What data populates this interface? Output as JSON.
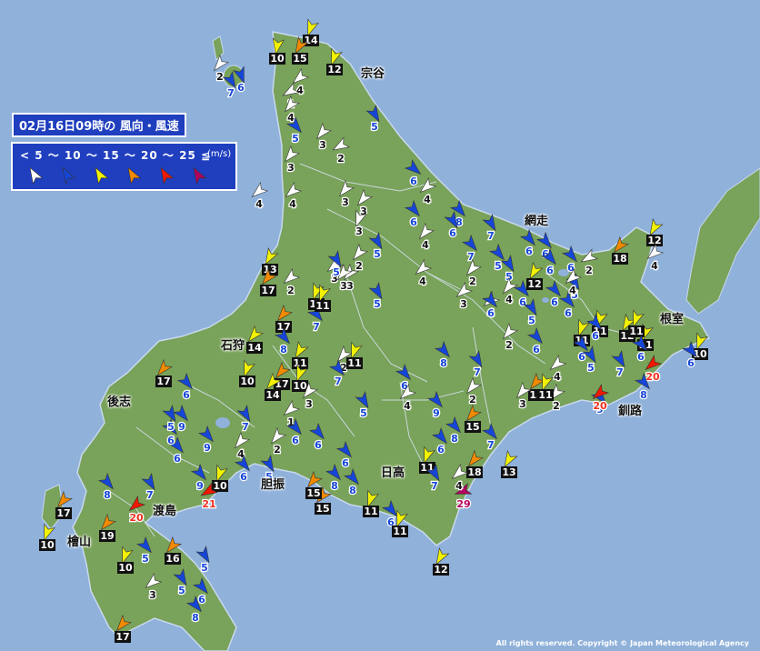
{
  "title": "02月16日09時の 風向・風速",
  "legend": {
    "scale": "< 5 ～ 10 ～ 15 ～ 20 ～ 25 ≦",
    "unit": "(m/s)",
    "levels": [
      {
        "color": "#ffffff"
      },
      {
        "color": "#1646d8"
      },
      {
        "color": "#f2f200"
      },
      {
        "color": "#f28a00"
      },
      {
        "color": "#f01800"
      },
      {
        "color": "#b3005e"
      }
    ]
  },
  "regions": {
    "soya": "宗谷",
    "abashiri": "網走",
    "nemuro": "根室",
    "ishikari": "石狩",
    "shiribeshi": "後志",
    "kushiro": "釧路",
    "iburi": "胆振",
    "hidaka": "日高",
    "oshima": "渡島",
    "hiyama": "檜山"
  },
  "copyright": "All rights reserved. Copyright © Japan Meteorological Agency",
  "colors": {
    "sea": "#8fb1da",
    "land": "#79a25a",
    "border": "#c9d8ee"
  },
  "observations": [
    {
      "speed": 14,
      "dir": 200
    },
    {
      "speed": 15,
      "dir": 210
    },
    {
      "speed": 10,
      "dir": 190
    },
    {
      "speed": 12,
      "dir": 200
    },
    {
      "speed": 2,
      "dir": 220
    },
    {
      "speed": 6,
      "dir": 160
    },
    {
      "speed": 7,
      "dir": 150
    },
    {
      "speed": 4,
      "dir": 230
    },
    {
      "speed": 1,
      "dir": 240
    },
    {
      "speed": 4,
      "dir": 220
    },
    {
      "speed": 5,
      "dir": 140
    },
    {
      "speed": 3,
      "dir": 220
    },
    {
      "speed": 5,
      "dir": 150
    },
    {
      "speed": 2,
      "dir": 240
    },
    {
      "speed": 3,
      "dir": 220
    },
    {
      "speed": 4,
      "dir": 230
    },
    {
      "speed": 6,
      "dir": 130
    },
    {
      "speed": 4,
      "dir": 230
    },
    {
      "speed": 8,
      "dir": 140
    },
    {
      "speed": 6,
      "dir": 140
    },
    {
      "speed": 6,
      "dir": 150
    },
    {
      "speed": 3,
      "dir": 220
    },
    {
      "speed": 3,
      "dir": 220
    },
    {
      "speed": 4,
      "dir": 230
    },
    {
      "speed": 3,
      "dir": 200
    },
    {
      "speed": 7,
      "dir": 150
    },
    {
      "speed": 5,
      "dir": 150
    },
    {
      "speed": 2,
      "dir": 220
    },
    {
      "speed": 3,
      "dir": 220
    },
    {
      "speed": 7,
      "dir": 140
    },
    {
      "speed": 4,
      "dir": 220
    },
    {
      "speed": 13,
      "dir": 210
    },
    {
      "speed": 17,
      "dir": 220
    },
    {
      "speed": 2,
      "dir": 230
    },
    {
      "speed": 11,
      "dir": 200
    },
    {
      "speed": 3,
      "dir": 230
    },
    {
      "speed": 5,
      "dir": 140
    },
    {
      "speed": 6,
      "dir": 140
    },
    {
      "speed": 2,
      "dir": 220
    },
    {
      "speed": 3,
      "dir": 220
    },
    {
      "speed": 5,
      "dir": 150
    },
    {
      "speed": 6,
      "dir": 140
    },
    {
      "speed": 6,
      "dir": 140
    },
    {
      "speed": 2,
      "dir": 240
    },
    {
      "speed": 17,
      "dir": 220
    },
    {
      "speed": 7,
      "dir": 140
    },
    {
      "speed": 14,
      "dir": 220
    },
    {
      "speed": 8,
      "dir": 140
    },
    {
      "speed": 11,
      "dir": 210
    },
    {
      "speed": 4,
      "dir": 230
    },
    {
      "speed": 3,
      "dir": 230
    },
    {
      "speed": 4,
      "dir": 230
    },
    {
      "speed": 11,
      "dir": 200
    },
    {
      "speed": 11,
      "dir": 200
    },
    {
      "speed": 2,
      "dir": 220
    },
    {
      "speed": 5,
      "dir": 150
    },
    {
      "speed": 12,
      "dir": 210
    },
    {
      "speed": 10,
      "dir": 200
    },
    {
      "speed": 17,
      "dir": 220
    },
    {
      "speed": 10,
      "dir": 200
    },
    {
      "speed": 7,
      "dir": 140
    },
    {
      "speed": 11,
      "dir": 200
    },
    {
      "speed": 3,
      "dir": 220
    },
    {
      "speed": 5,
      "dir": 150
    },
    {
      "speed": 6,
      "dir": 140
    },
    {
      "speed": 8,
      "dir": 140
    },
    {
      "speed": 7,
      "dir": 150
    },
    {
      "speed": 2,
      "dir": 220
    },
    {
      "speed": 5,
      "dir": 150
    },
    {
      "speed": 4,
      "dir": 220
    },
    {
      "speed": 14,
      "dir": 220
    },
    {
      "speed": 6,
      "dir": 140
    },
    {
      "speed": 17,
      "dir": 220
    },
    {
      "speed": 9,
      "dir": 140
    },
    {
      "speed": 6,
      "dir": 140
    },
    {
      "speed": 6,
      "dir": 140
    },
    {
      "speed": 1,
      "dir": 230
    },
    {
      "speed": 9,
      "dir": 140
    },
    {
      "speed": 4,
      "dir": 220
    },
    {
      "speed": 2,
      "dir": 220
    },
    {
      "speed": 6,
      "dir": 140
    },
    {
      "speed": 7,
      "dir": 150
    },
    {
      "speed": 4,
      "dir": 230
    },
    {
      "speed": 8,
      "dir": 140
    },
    {
      "speed": 9,
      "dir": 140
    },
    {
      "speed": 6,
      "dir": 140
    },
    {
      "speed": 6,
      "dir": 140
    },
    {
      "speed": 5,
      "dir": 150
    },
    {
      "speed": 9,
      "dir": 140
    },
    {
      "speed": 8,
      "dir": 140
    },
    {
      "speed": 6,
      "dir": 140
    },
    {
      "speed": 7,
      "dir": 140
    },
    {
      "speed": 13,
      "dir": 210
    },
    {
      "speed": 10,
      "dir": 200
    },
    {
      "speed": 21,
      "dir": 240
    },
    {
      "speed": 15,
      "dir": 220
    },
    {
      "speed": 15,
      "dir": 220
    },
    {
      "speed": 8,
      "dir": 140
    },
    {
      "speed": 11,
      "dir": 200
    },
    {
      "speed": 11,
      "dir": 200
    },
    {
      "speed": 6,
      "dir": 140
    },
    {
      "speed": 11,
      "dir": 200
    },
    {
      "speed": 12,
      "dir": 210
    },
    {
      "speed": 18,
      "dir": 220
    },
    {
      "speed": 29,
      "dir": 250
    },
    {
      "speed": 7,
      "dir": 150
    },
    {
      "speed": 6,
      "dir": 140
    },
    {
      "speed": 4,
      "dir": 230
    },
    {
      "speed": 5,
      "dir": 150
    },
    {
      "speed": 8,
      "dir": 140
    },
    {
      "speed": 17,
      "dir": 220
    },
    {
      "speed": 10,
      "dir": 200
    },
    {
      "speed": 20,
      "dir": 230
    },
    {
      "speed": 19,
      "dir": 220
    },
    {
      "speed": 7,
      "dir": 150
    },
    {
      "speed": 10,
      "dir": 200
    },
    {
      "speed": 5,
      "dir": 140
    },
    {
      "speed": 16,
      "dir": 220
    },
    {
      "speed": 5,
      "dir": 150
    },
    {
      "speed": 5,
      "dir": 150
    },
    {
      "speed": 3,
      "dir": 230
    },
    {
      "speed": 6,
      "dir": 140
    },
    {
      "speed": 8,
      "dir": 140
    },
    {
      "speed": 17,
      "dir": 220
    },
    {
      "speed": 15,
      "dir": 220
    },
    {
      "speed": 15,
      "dir": 220
    },
    {
      "speed": 3,
      "dir": 220
    },
    {
      "speed": 2,
      "dir": 220
    },
    {
      "speed": 9,
      "dir": 140
    },
    {
      "speed": 4,
      "dir": 230
    },
    {
      "speed": 11,
      "dir": 200
    },
    {
      "speed": 20,
      "dir": 230
    },
    {
      "speed": 20,
      "dir": 230
    },
    {
      "speed": 8,
      "dir": 140
    },
    {
      "speed": 11,
      "dir": 200
    },
    {
      "speed": 12,
      "dir": 210
    },
    {
      "speed": 10,
      "dir": 200
    },
    {
      "speed": 6,
      "dir": 140
    },
    {
      "speed": 18,
      "dir": 220
    },
    {
      "speed": 12,
      "dir": 210
    },
    {
      "speed": 6,
      "dir": 140
    },
    {
      "speed": 11,
      "dir": 200
    },
    {
      "speed": 11,
      "dir": 200
    },
    {
      "speed": 6,
      "dir": 140
    },
    {
      "speed": 6,
      "dir": 140
    },
    {
      "speed": 2,
      "dir": 220
    },
    {
      "speed": 6,
      "dir": 140
    },
    {
      "speed": 6,
      "dir": 140
    },
    {
      "speed": 5,
      "dir": 150
    },
    {
      "speed": 6,
      "dir": 140
    },
    {
      "speed": 5,
      "dir": 150
    },
    {
      "speed": 4,
      "dir": 230
    },
    {
      "speed": 6,
      "dir": 140
    },
    {
      "speed": 6,
      "dir": 140
    },
    {
      "speed": 5,
      "dir": 150
    },
    {
      "speed": 7,
      "dir": 150
    },
    {
      "speed": 6,
      "dir": 140
    },
    {
      "speed": 4,
      "dir": 230
    },
    {
      "speed": 5,
      "dir": 150
    },
    {
      "speed": 7,
      "dir": 150
    },
    {
      "speed": 11,
      "dir": 200
    },
    {
      "speed": 10,
      "dir": 200
    },
    {
      "speed": 6,
      "dir": 140
    },
    {
      "speed": 2,
      "dir": 220
    }
  ]
}
